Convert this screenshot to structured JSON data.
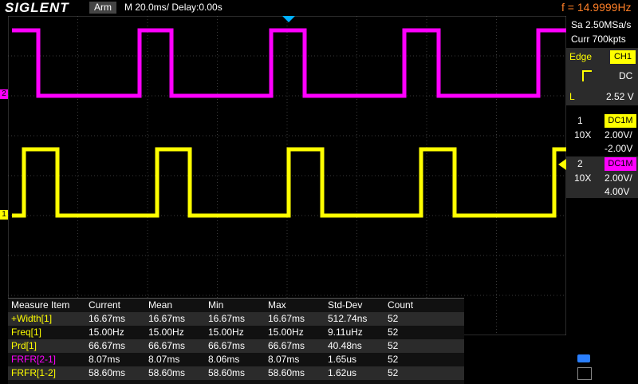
{
  "header": {
    "logo": "SIGLENT",
    "arm": "Arm",
    "timebase": "M 20.0ms/ Delay:0.00s",
    "frequency": "f = 14.9999Hz"
  },
  "side_panel": {
    "sample_rate": "Sa 2.50MSa/s",
    "memory": "Curr 700kpts",
    "trigger_mode": "Edge",
    "trigger_source": "CH1",
    "coupling": "DC",
    "level_label": "L",
    "level_value": "2.52 V",
    "ch1": {
      "num": "1",
      "coupling": "DC1M",
      "probe": "10X",
      "scale": "2.00V/",
      "offset": "-2.00V"
    },
    "ch2": {
      "num": "2",
      "coupling": "DC1M",
      "probe": "10X",
      "scale": "2.00V/",
      "offset": "4.00V"
    }
  },
  "markers": {
    "ch1": "1",
    "ch2": "2"
  },
  "measure": {
    "headers": [
      "Measure Item",
      "Current",
      "Mean",
      "Min",
      "Max",
      "Std-Dev",
      "Count"
    ],
    "rows": [
      [
        "+Width[1]",
        "16.67ms",
        "16.67ms",
        "16.67ms",
        "16.67ms",
        "512.74ns",
        "52"
      ],
      [
        "Freq[1]",
        "15.00Hz",
        "15.00Hz",
        "15.00Hz",
        "15.00Hz",
        "9.11uHz",
        "52"
      ],
      [
        "Prd[1]",
        "66.67ms",
        "66.67ms",
        "66.67ms",
        "66.67ms",
        "40.48ns",
        "52"
      ],
      [
        "FRFR[2-1]",
        "8.07ms",
        "8.07ms",
        "8.06ms",
        "8.07ms",
        "1.65us",
        "52"
      ],
      [
        "FRFR[1-2]",
        "58.60ms",
        "58.60ms",
        "58.60ms",
        "58.60ms",
        "1.62us",
        "52"
      ]
    ]
  },
  "colors": {
    "ch1": "#ffff00",
    "ch2": "#ff00ff",
    "accent": "#ff7f27",
    "trigger": "#00b0ff"
  }
}
